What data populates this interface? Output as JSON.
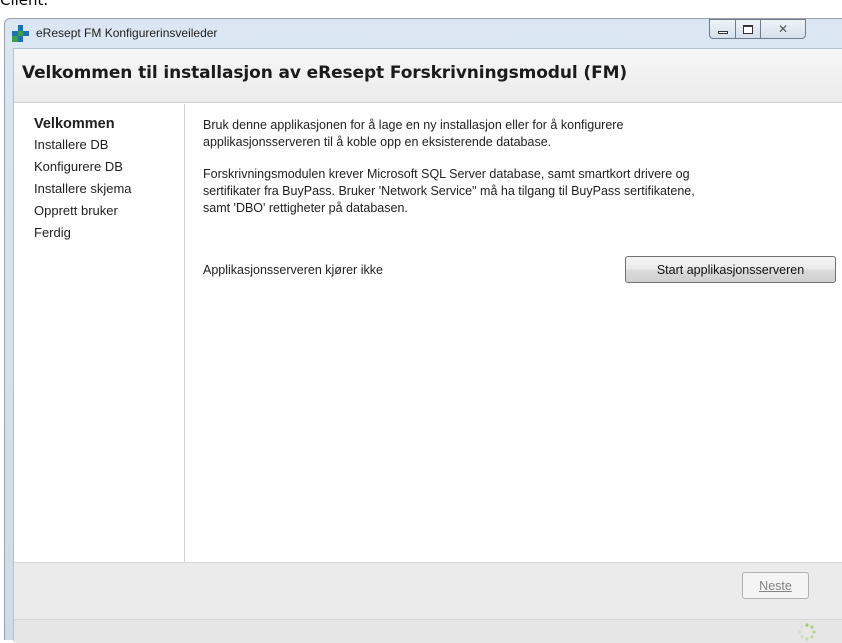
{
  "page": {
    "top_cut_text": "Client."
  },
  "window": {
    "title": "eResept FM Konfigurerinsveileder",
    "icons": {
      "app": "plus-cross-icon",
      "minimize": "minimize-icon",
      "maximize": "maximize-icon",
      "close": "close-icon"
    },
    "close_glyph": "✕"
  },
  "header": {
    "title": "Velkommen til installasjon av eResept Forskrivningsmodul (FM)"
  },
  "steps": [
    {
      "label": "Velkommen",
      "active": true
    },
    {
      "label": "Installere DB",
      "active": false
    },
    {
      "label": "Konfigurere DB",
      "active": false
    },
    {
      "label": "Installere skjema",
      "active": false
    },
    {
      "label": "Opprett bruker",
      "active": false
    },
    {
      "label": "Ferdig",
      "active": false
    }
  ],
  "main": {
    "intro": "Bruk denne applikasjonen for å lage en ny installasjon eller for å konfigurere\napplikasjonsserveren til å koble opp en eksisterende database.",
    "requirements": "Forskrivningsmodulen krever Microsoft SQL Server database, samt smartkort drivere og\nsertifikater fra BuyPass.   Bruker 'Network Service\" må ha tilgang til BuyPass sertifikatene,\nsamt 'DBO' rettigheter på databasen.",
    "status_text": "Applikasjonsserveren kjører ikke",
    "start_button": "Start applikasjonsserveren"
  },
  "footer": {
    "next_button": "Neste",
    "next_enabled": false,
    "busy_icon": "spinner-icon"
  },
  "colors": {
    "accent_blue": "#1f6fb5",
    "accent_green": "#3aa04a"
  }
}
